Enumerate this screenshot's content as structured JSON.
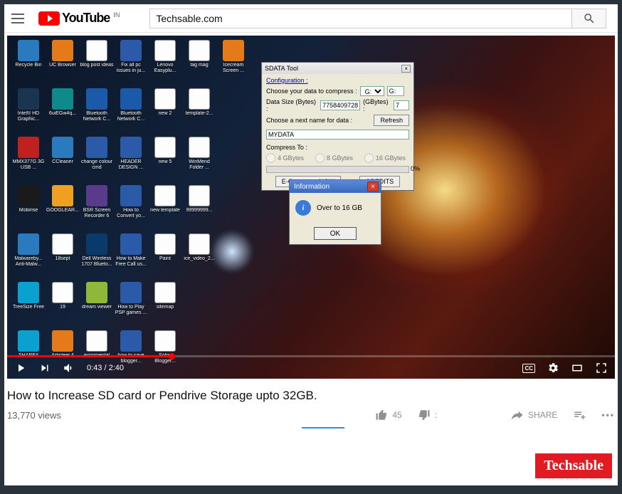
{
  "header": {
    "site": "YouTube",
    "region": "IN",
    "search_value": "Techsable.com"
  },
  "desktop_icons": [
    {
      "label": "Recycle Bin",
      "c": "c-blue"
    },
    {
      "label": "UC Browser",
      "c": "c-orange"
    },
    {
      "label": "blog post ideas",
      "c": "c-white"
    },
    {
      "label": "Fix all pc issues in ju...",
      "c": "c-word"
    },
    {
      "label": "Lenovo Easyplu...",
      "c": "c-white"
    },
    {
      "label": "tag mag",
      "c": "c-white"
    },
    {
      "label": "Icecream Screen ...",
      "c": "c-orange"
    },
    {
      "label": "Intel® HD Graphic...",
      "c": "c-dark"
    },
    {
      "label": "6uiEGw4q...",
      "c": "c-teal"
    },
    {
      "label": "Bluetooth Network C...",
      "c": "c-bt"
    },
    {
      "label": "Bluetooth Network C...",
      "c": "c-bt"
    },
    {
      "label": "new 2",
      "c": "c-white"
    },
    {
      "label": "template-2...",
      "c": "c-white"
    },
    {
      "label": "",
      "c": ""
    },
    {
      "label": "MMX377G 3G USB ...",
      "c": "c-red"
    },
    {
      "label": "CCleaner",
      "c": "c-blue"
    },
    {
      "label": "change colour cmd",
      "c": "c-word"
    },
    {
      "label": "HEADER DESIGN ...",
      "c": "c-word"
    },
    {
      "label": "new 5",
      "c": "c-white"
    },
    {
      "label": "WinMend Folder ...",
      "c": "c-white"
    },
    {
      "label": "",
      "c": ""
    },
    {
      "label": "Mobirise",
      "c": "c-black"
    },
    {
      "label": "GOOGLEAR...",
      "c": "c-yellow"
    },
    {
      "label": "BSR Screen Recorder 6",
      "c": "c-purple"
    },
    {
      "label": "How to Convert yo...",
      "c": "c-word"
    },
    {
      "label": "new template",
      "c": "c-white"
    },
    {
      "label": "99999999...",
      "c": "c-white"
    },
    {
      "label": " ",
      "c": ""
    },
    {
      "label": "Malwareby... Anti-Malw...",
      "c": "c-blue"
    },
    {
      "label": "18sept",
      "c": "c-white"
    },
    {
      "label": "Dell Wireless 1707 Blueto...",
      "c": "c-navy"
    },
    {
      "label": "How to Make Free Call us...",
      "c": "c-word"
    },
    {
      "label": "Paint",
      "c": "c-white"
    },
    {
      "label": "ice_video_2...",
      "c": "c-white"
    },
    {
      "label": "",
      "c": ""
    },
    {
      "label": "TreeSize Free",
      "c": "c-sky"
    },
    {
      "label": "19",
      "c": "c-white"
    },
    {
      "label": "dream viewer",
      "c": "c-dw"
    },
    {
      "label": "How to Play PSP games ...",
      "c": "c-word"
    },
    {
      "label": "sitemap",
      "c": "c-white"
    },
    {
      "label": "",
      "c": ""
    },
    {
      "label": "",
      "c": ""
    },
    {
      "label": "SHARE#",
      "c": "c-sky"
    },
    {
      "label": "Artisteer.4",
      "c": "c-orange"
    },
    {
      "label": "exprimental",
      "c": "c-white"
    },
    {
      "label": "how to save blogger...",
      "c": "c-word"
    },
    {
      "label": "Solon Blogger...",
      "c": "c-white"
    }
  ],
  "sdata": {
    "title": "SDATA Tool",
    "config_label": "Configuration :",
    "choose_data": "Choose your data to compress :",
    "drive_sel": "G:\\",
    "drive_right": "G:",
    "size_bytes_label": "Data Size (Bytes) :",
    "size_bytes": "7758409728",
    "size_gb_label": "(GBytes) :",
    "size_gb": "7",
    "next_name_label": "Choose a next name for data :",
    "refresh": "Refresh",
    "name_value": "MYDATA",
    "compress_to": "Compress To :",
    "opt4": "4 GBytes",
    "opt8": "8 GBytes",
    "opt16": "16 GBytes",
    "ecompress": "E-Compress NOW",
    "credits": "CREDITS"
  },
  "info": {
    "title": "Information",
    "message": "Over to 16 GB",
    "ok": "OK"
  },
  "player": {
    "current": "0:43",
    "total": "2:40",
    "cc": "CC"
  },
  "meta": {
    "title": "How to Increase SD card or Pendrive Storage upto 32GB.",
    "views": "13,770 views",
    "likes": "45",
    "dislikes": ":",
    "share": "SHARE"
  },
  "watermark": "Techsable"
}
